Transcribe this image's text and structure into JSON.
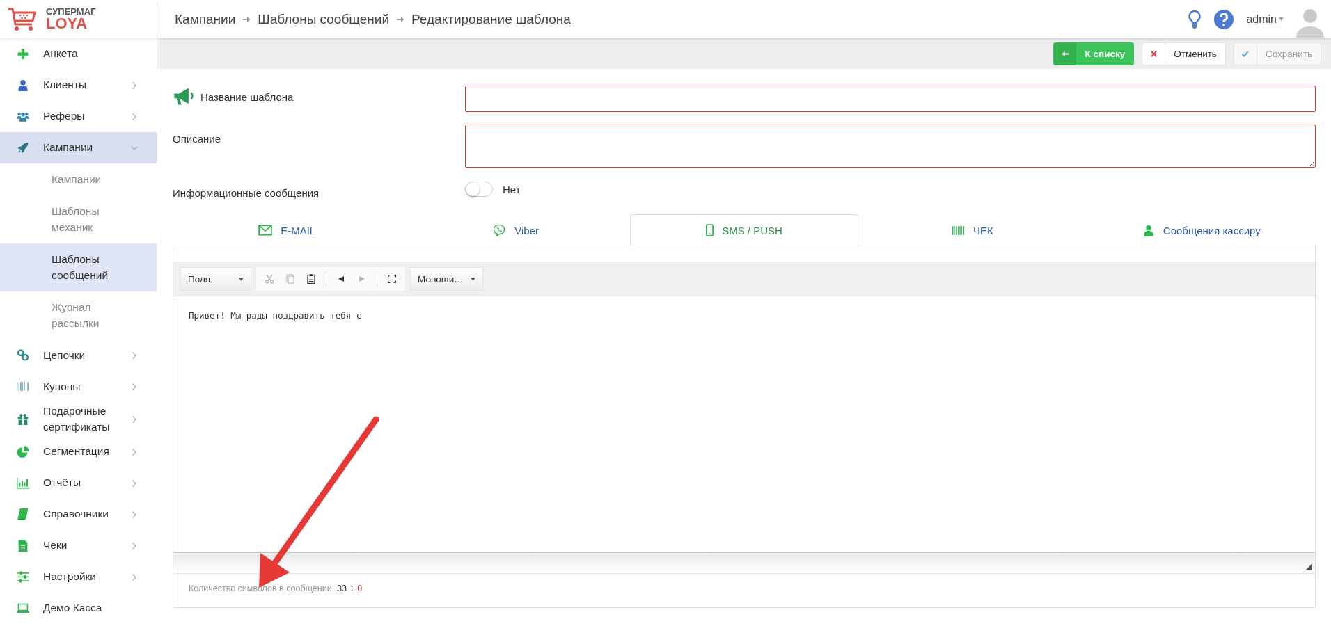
{
  "logo": {
    "line1": "СУПЕРМАГ",
    "line2": "LOYA"
  },
  "sidebar": {
    "items": [
      {
        "label": "Анкета",
        "kind": "plus",
        "expandable": false,
        "selected": false
      },
      {
        "label": "Клиенты",
        "kind": "user",
        "expandable": true,
        "expanded": false,
        "selected": false
      },
      {
        "label": "Реферы",
        "kind": "users",
        "expandable": true,
        "expanded": false,
        "selected": false
      },
      {
        "label": "Кампании",
        "kind": "rocket",
        "expandable": true,
        "expanded": true,
        "selected": true,
        "children": [
          {
            "label": "Кампании",
            "selected": false
          },
          {
            "label": "Шаблоны механик",
            "selected": false
          },
          {
            "label": "Шаблоны сообщений",
            "selected": true
          },
          {
            "label": "Журнал рассылки",
            "selected": false
          }
        ]
      },
      {
        "label": "Цепочки",
        "kind": "link",
        "expandable": true,
        "expanded": false,
        "selected": false
      },
      {
        "label": "Купоны",
        "kind": "barcode",
        "expandable": true,
        "expanded": false,
        "selected": false
      },
      {
        "label": "Подарочные сертификаты",
        "kind": "gift",
        "expandable": true,
        "expanded": false,
        "selected": false
      },
      {
        "label": "Сегментация",
        "kind": "pie",
        "expandable": true,
        "expanded": false,
        "selected": false
      },
      {
        "label": "Отчёты",
        "kind": "chart",
        "expandable": true,
        "expanded": false,
        "selected": false
      },
      {
        "label": "Справочники",
        "kind": "book",
        "expandable": true,
        "expanded": false,
        "selected": false
      },
      {
        "label": "Чеки",
        "kind": "file",
        "expandable": true,
        "expanded": false,
        "selected": false
      },
      {
        "label": "Настройки",
        "kind": "sliders",
        "expandable": true,
        "expanded": false,
        "selected": false
      },
      {
        "label": "Демо Касса",
        "kind": "laptop",
        "expandable": false,
        "selected": false
      }
    ]
  },
  "header": {
    "breadcrumbs": [
      "Кампании",
      "Шаблоны сообщений",
      "Редактирование шаблона"
    ],
    "user": "admin"
  },
  "actions": [
    {
      "label": "К списку",
      "kind": "back",
      "disabled": false
    },
    {
      "label": "Отменить",
      "kind": "cancel",
      "disabled": false
    },
    {
      "label": "Сохранить",
      "kind": "save",
      "disabled": true
    }
  ],
  "form": {
    "name": {
      "label": "Название шаблона",
      "invalid": true
    },
    "description": {
      "label": "Описание",
      "invalid": true
    },
    "info_messages": {
      "label": "Информационные сообщения",
      "on": false,
      "state_text": "Нет"
    }
  },
  "tabs": [
    {
      "label": "E-MAIL",
      "kind": "mail",
      "selected": false
    },
    {
      "label": "Viber",
      "kind": "viber",
      "selected": false
    },
    {
      "label": "SMS / PUSH",
      "kind": "phone",
      "selected": true
    },
    {
      "label": "ЧЕК",
      "kind": "barcode",
      "selected": false
    },
    {
      "label": "Сообщения кассиру",
      "kind": "user",
      "selected": false
    }
  ],
  "editor": {
    "fields_dropdown": "Поля",
    "font_dropdown": "Моноши…",
    "tool_groups": [
      [
        {
          "kind": "cut",
          "disabled": true
        },
        {
          "kind": "copy",
          "disabled": true
        },
        {
          "kind": "paste",
          "disabled": false
        }
      ],
      [
        {
          "kind": "undo",
          "disabled": false
        },
        {
          "kind": "redo",
          "disabled": true
        }
      ],
      [
        {
          "kind": "fullscreen",
          "disabled": false
        }
      ]
    ],
    "text": "Привет! Мы рады поздравить тебя с",
    "counter": {
      "label": "Количество символов в сообщении:",
      "count": "33",
      "separator": "+",
      "extra": "0"
    }
  }
}
